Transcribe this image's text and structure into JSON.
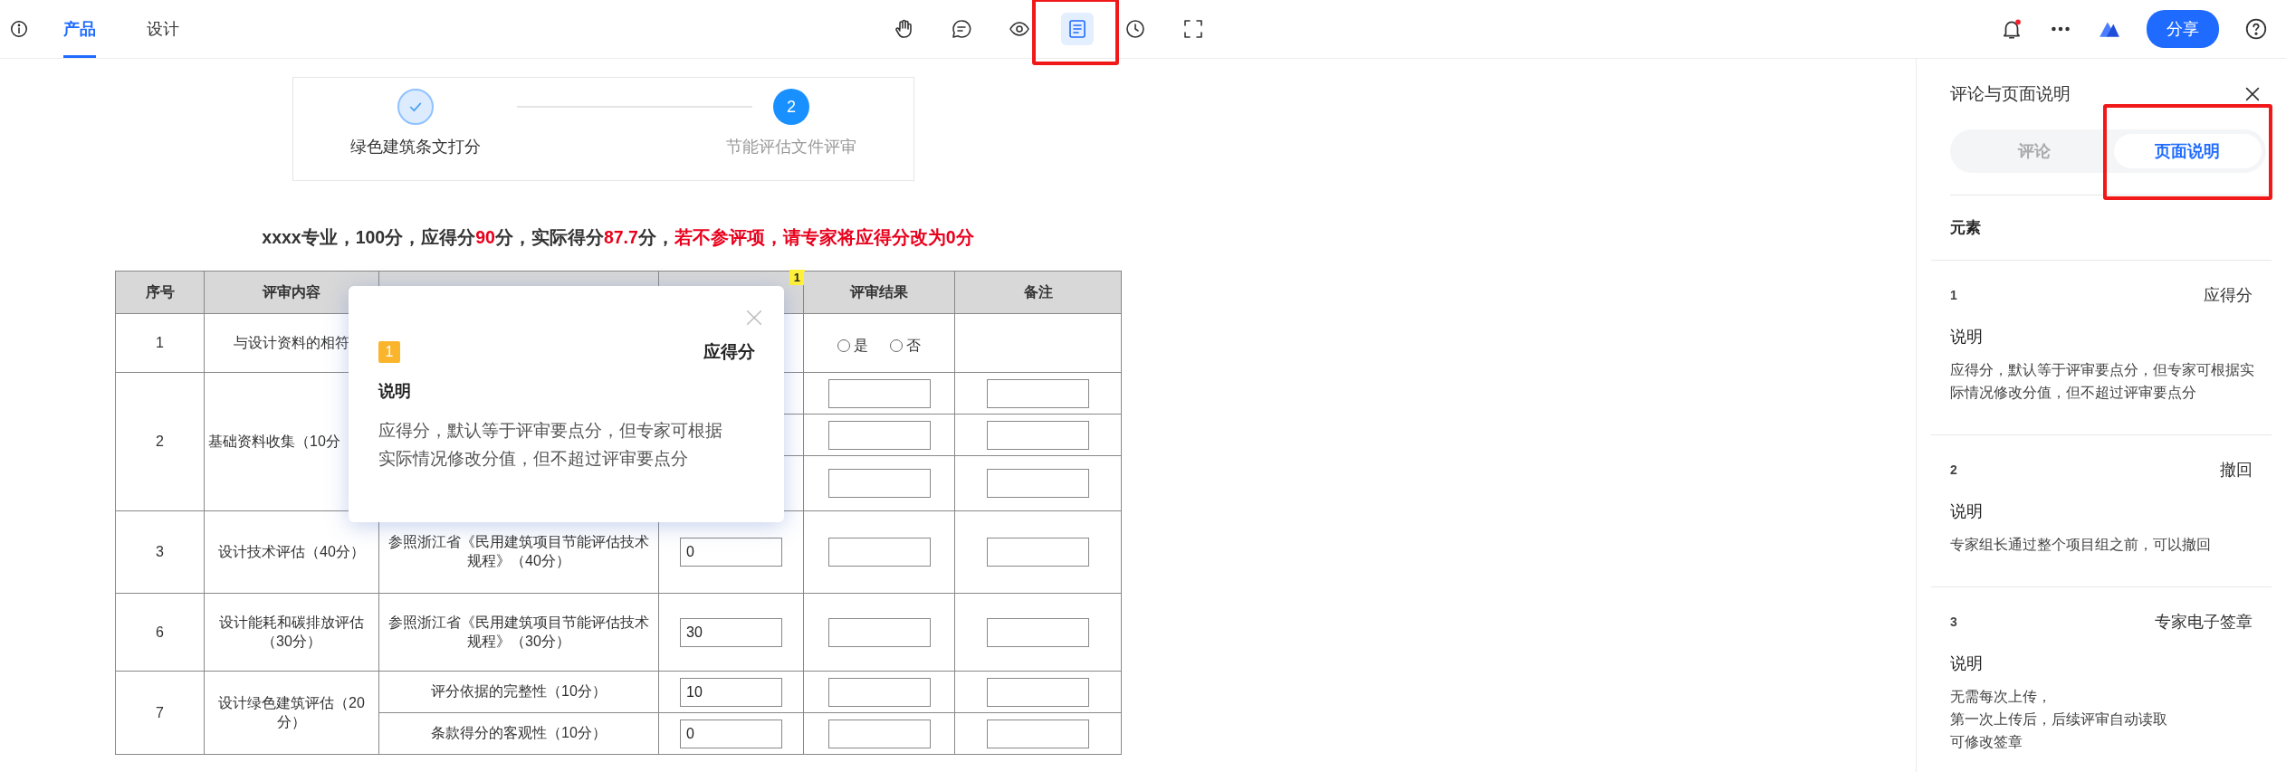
{
  "topbar": {
    "tabs": [
      {
        "label": "产品",
        "selected": true
      },
      {
        "label": "设计",
        "selected": false
      }
    ],
    "tools": [
      {
        "kind": "hand",
        "selected": false,
        "highlighted": false
      },
      {
        "kind": "comment",
        "selected": false,
        "highlighted": false
      },
      {
        "kind": "eye",
        "selected": false,
        "highlighted": false
      },
      {
        "kind": "notes",
        "selected": true,
        "highlighted": true
      },
      {
        "kind": "clock",
        "selected": false,
        "highlighted": false
      },
      {
        "kind": "fullscreen",
        "selected": false,
        "highlighted": false
      }
    ],
    "notification_dot": true,
    "share_button": "分享"
  },
  "stepper": {
    "steps": [
      {
        "label": "绿色建筑条文打分",
        "kind": "done"
      },
      {
        "label": "节能评估文件评审",
        "number": "2",
        "kind": "current"
      }
    ]
  },
  "heading": [
    {
      "text": "xxxx专业，100分，应得分",
      "emphasis": false
    },
    {
      "text": "90",
      "emphasis": true
    },
    {
      "text": "分，实际得分",
      "emphasis": false
    },
    {
      "text": "87.7",
      "emphasis": true
    },
    {
      "text": "分，",
      "emphasis": false
    },
    {
      "text": "若不参评项，请专家将应得分改为0分",
      "emphasis": true
    }
  ],
  "table": {
    "columns": [
      {
        "label": "序号"
      },
      {
        "label": "评审内容"
      },
      {},
      {
        "badge": "1",
        "highlighted": true
      },
      {
        "label": "评审结果"
      },
      {
        "label": "备注"
      }
    ],
    "rows": [
      {
        "no": "1",
        "content": "与设计资料的相符",
        "items": [
          {
            "result": {
              "kind": "radio",
              "options": [
                {
                  "label": "是",
                  "selected": false
                },
                {
                  "label": "否",
                  "selected": false
                }
              ]
            }
          }
        ]
      },
      {
        "no": "2",
        "content": "基础资料收集（10分",
        "items": [
          {
            "result": {
              "kind": "field"
            },
            "note": {
              "kind": "field"
            }
          },
          {
            "result": {
              "kind": "field"
            },
            "note": {
              "kind": "field"
            }
          },
          {
            "result": {
              "kind": "field"
            },
            "note": {
              "kind": "field"
            }
          }
        ]
      },
      {
        "no": "3",
        "content": "设计技术评估（40分）",
        "items": [
          {
            "points": "参照浙江省《民用建筑项目节能评估技术规程》（40分）",
            "score": "0",
            "result": {
              "kind": "field"
            },
            "note": {
              "kind": "field"
            }
          }
        ]
      },
      {
        "no": "6",
        "content": "设计能耗和碳排放评估（30分）",
        "items": [
          {
            "points": "参照浙江省《民用建筑项目节能评估技术规程》（30分）",
            "score": "30",
            "result": {
              "kind": "field"
            },
            "note": {
              "kind": "field"
            }
          }
        ]
      },
      {
        "no": "7",
        "content": "设计绿色建筑评估（20分）",
        "items": [
          {
            "points": "评分依据的完整性（10分）",
            "score": "10",
            "result": {
              "kind": "field"
            },
            "note": {
              "kind": "field"
            }
          },
          {
            "points": "条款得分的客观性（10分）",
            "score": "0",
            "result": {
              "kind": "field"
            },
            "note": {
              "kind": "field"
            }
          }
        ]
      }
    ]
  },
  "popover": {
    "badge": "1",
    "title": "应得分",
    "label": "说明",
    "text": "应得分，默认等于评审要点分，但专家可根据实际情况修改分值，但不超过评审要点分"
  },
  "panel": {
    "title": "评论与页面说明",
    "tabs": [
      {
        "label": "评论",
        "selected": false,
        "highlighted": false
      },
      {
        "label": "页面说明",
        "selected": true,
        "highlighted": true
      }
    ],
    "section": "元素",
    "items": [
      {
        "number": "1",
        "name": "应得分",
        "label": "说明",
        "lines": [
          "应得分，默认等于评审要点分，但专家可根据实际情况修改分值，但不超过评审要点分"
        ]
      },
      {
        "number": "2",
        "name": "撤回",
        "label": "说明",
        "lines": [
          "专家组长通过整个项目组之前，可以撤回"
        ]
      },
      {
        "number": "3",
        "name": "专家电子签章",
        "label": "说明",
        "lines": [
          "无需每次上传，",
          "第一次上传后，后续评审自动读取",
          "可修改签章"
        ]
      }
    ]
  }
}
